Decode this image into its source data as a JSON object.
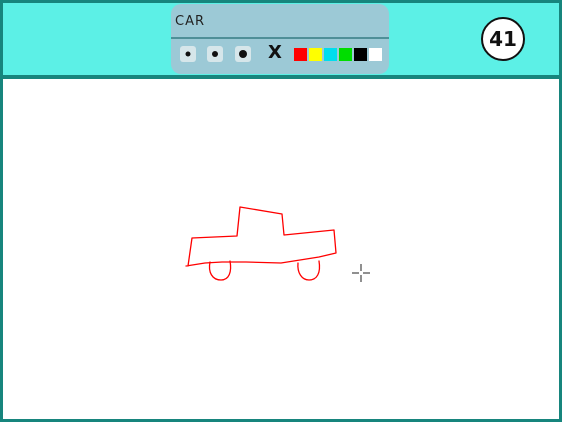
{
  "game": {
    "word": "CAR",
    "timer": "41"
  },
  "toolbar": {
    "brush_sizes": [
      "small",
      "medium",
      "large"
    ],
    "clear_label": "X",
    "colors": [
      "#ff0000",
      "#ffff00",
      "#00ddee",
      "#00dd00",
      "#000000",
      "#ffffff"
    ]
  },
  "drawing": {
    "stroke_color": "#ff0000",
    "subject": "car sketch"
  },
  "icons": {
    "cursor": "crosshair-cursor-icon"
  }
}
